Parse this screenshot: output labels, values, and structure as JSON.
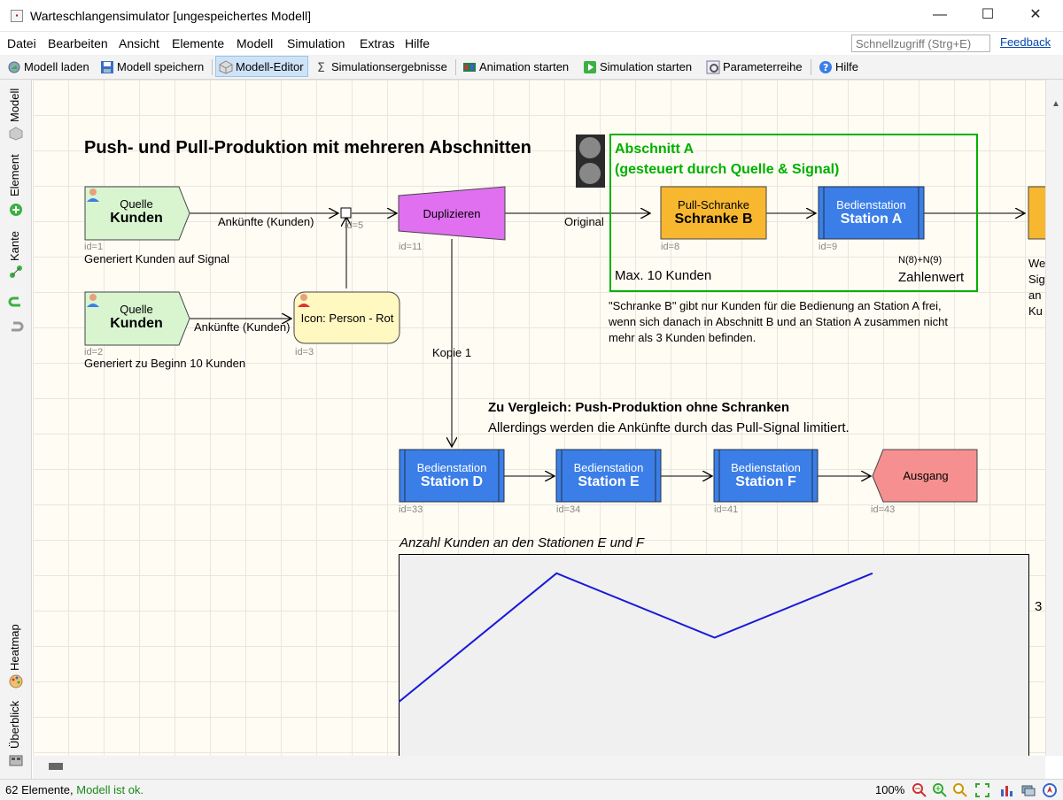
{
  "window": {
    "title": "Warteschlangensimulator [ungespeichertes Modell]",
    "minimize": "—",
    "maximize": "☐",
    "close": "✕"
  },
  "menu": {
    "items": [
      "Datei",
      "Bearbeiten",
      "Ansicht",
      "Elemente",
      "Modell",
      "Simulation",
      "Extras",
      "Hilfe"
    ],
    "quick_access_placeholder": "Schnellzugriff (Strg+E)",
    "feedback": "Feedback"
  },
  "toolbar": {
    "load": "Modell laden",
    "save": "Modell speichern",
    "editor": "Modell-Editor",
    "results": "Simulationsergebnisse",
    "animation": "Animation starten",
    "simulation": "Simulation starten",
    "params": "Parameterreihe",
    "help": "Hilfe"
  },
  "lefttabs": {
    "model": "Modell",
    "element": "Element",
    "edge": "Kante",
    "heatmap": "Heatmap",
    "overview": "Überblick"
  },
  "canvas": {
    "heading": "Push- und Pull-Produktion mit mehreren Abschnitten",
    "section_a_title": "Abschnitt A",
    "section_a_sub": "(gesteuert durch Quelle & Signal)",
    "section_a_max": "Max. 10 Kunden",
    "section_a_counter_formula": "N(8)+N(9)",
    "section_a_counter_label": "Zahlenwert",
    "section_a_desc": [
      "\"Schranke B\" gibt nur Kunden für die Bedienung an Station A frei,",
      "wenn sich danach in Abschnitt B und an Station A zusammen nicht",
      "mehr als 3 Kunden befinden."
    ],
    "right_cut_text": [
      "We",
      "Sig",
      "an",
      "Ku"
    ],
    "compare_title": "Zu Vergleich: Push-Produktion ohne Schranken",
    "compare_sub": "Allerdings werden die Ankünfte durch das Pull-Signal limitiert.",
    "nodes": {
      "source1": {
        "sub": "Quelle",
        "main": "Kunden",
        "id": "id=1",
        "note": "Generiert Kunden auf Signal"
      },
      "source2": {
        "sub": "Quelle",
        "main": "Kunden",
        "id": "id=2",
        "note": "Generiert zu Beginn 10 Kunden"
      },
      "icon": {
        "label": "Icon: Person - Rot",
        "id": "id=3"
      },
      "join": {
        "id": "id=5"
      },
      "dup": {
        "label": "Duplizieren",
        "id": "id=11"
      },
      "barrier": {
        "sub": "Pull-Schranke",
        "main": "Schranke B",
        "id": "id=8"
      },
      "stationA": {
        "sub": "Bedienstation",
        "main": "Station A",
        "id": "id=9"
      },
      "stationD": {
        "sub": "Bedienstation",
        "main": "Station D",
        "id": "id=33"
      },
      "stationE": {
        "sub": "Bedienstation",
        "main": "Station E",
        "id": "id=34"
      },
      "stationF": {
        "sub": "Bedienstation",
        "main": "Station F",
        "id": "id=41"
      },
      "exit": {
        "label": "Ausgang",
        "id": "id=43"
      }
    },
    "edges": {
      "arrivals1": "Ankünfte (Kunden)",
      "arrivals2": "Ankünfte (Kunden)",
      "original": "Original",
      "copy1": "Kopie 1"
    },
    "chart_title": "Anzahl Kunden an den Stationen E und F",
    "chart_axis_tick": "3"
  },
  "chart_data": {
    "type": "line",
    "title": "Anzahl Kunden an den Stationen E und F",
    "x": [
      0,
      1,
      2,
      3
    ],
    "series": [
      {
        "values": [
          1,
          3,
          2,
          3
        ]
      }
    ],
    "ylim": [
      0,
      3.3
    ],
    "y_ticks": [
      "3"
    ]
  },
  "status": {
    "elements": "62 Elemente,",
    "model_ok": "Modell ist ok.",
    "zoom": "100%"
  },
  "colors": {
    "accent": "#0078d7",
    "section_green": "#00b000",
    "station_blue": "#3b7ee8",
    "barrier_orange": "#f7b830",
    "dup_magenta": "#d84ee8",
    "exit_red": "#f47c7c",
    "chart_line": "#1a1ad8"
  }
}
